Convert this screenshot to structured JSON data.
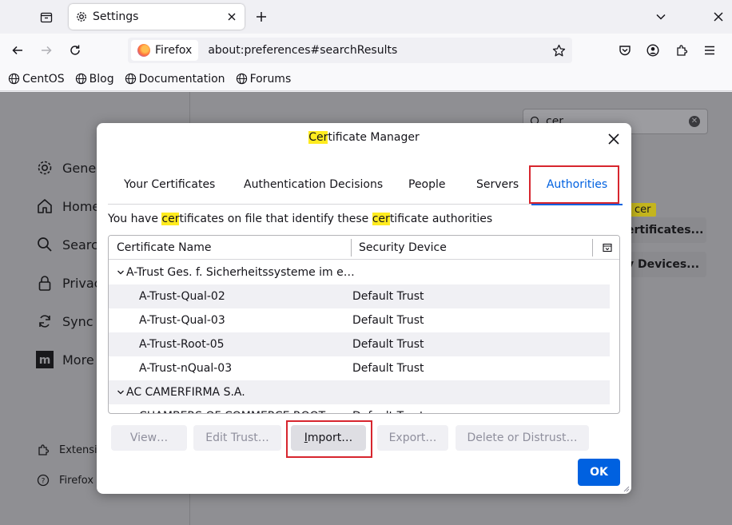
{
  "browser": {
    "tab_title": "Settings",
    "identity_label": "Firefox",
    "url": "about:preferences#searchResults",
    "bookmarks": [
      "CentOS",
      "Blog",
      "Documentation",
      "Forums"
    ]
  },
  "background_page": {
    "search_value": "cer",
    "categories": [
      "Gener",
      "Home",
      "Search",
      "Privac",
      "Sync",
      "More f"
    ],
    "footer_links": [
      "Extensi",
      "Firefox"
    ],
    "highlight_badge": "cer",
    "certificates_button": "ertificates...",
    "devices_button": "y Devices..."
  },
  "dialog": {
    "title_highlight": "Cer",
    "title_rest": "tificate Manager",
    "tabs": [
      "Your Certificates",
      "Authentication Decisions",
      "People",
      "Servers",
      "Authorities"
    ],
    "active_tab": "Authorities",
    "description": {
      "p1": "You have ",
      "h1": "cer",
      "p2": "tificates on file that identify these ",
      "h2": "cer",
      "p3": "tificate authorities"
    },
    "columns": [
      "Certificate Name",
      "Security Device"
    ],
    "rows": [
      {
        "type": "group",
        "name": "A-Trust Ges. f. Sicherheitssysteme im e…",
        "device": ""
      },
      {
        "type": "item",
        "name": "A-Trust-Qual-02",
        "device": "Default Trust"
      },
      {
        "type": "item",
        "name": "A-Trust-Qual-03",
        "device": "Default Trust"
      },
      {
        "type": "item",
        "name": "A-Trust-Root-05",
        "device": "Default Trust"
      },
      {
        "type": "item",
        "name": "A-Trust-nQual-03",
        "device": "Default Trust"
      },
      {
        "type": "group",
        "name": "AC CAMERFIRMA S.A.",
        "device": ""
      },
      {
        "type": "item",
        "name": "CHAMBERS OF COMMERCE ROOT",
        "device": "Default Trust"
      }
    ],
    "buttons": {
      "view": "View…",
      "edit_trust": "Edit Trust…",
      "import_underlined": "I",
      "import_rest": "mport…",
      "export": "Export…",
      "delete": "Delete or Distrust…",
      "ok": "OK"
    },
    "annotation_color": "#d7262e",
    "accent_color": "#0061e0",
    "highlight_color": "#ffeb1f"
  }
}
